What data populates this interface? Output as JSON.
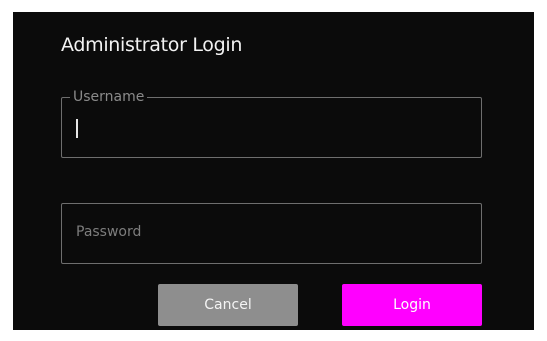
{
  "dialog": {
    "title": "Administrator Login",
    "username": {
      "label": "Username",
      "value": ""
    },
    "password": {
      "placeholder": "Password",
      "value": ""
    },
    "buttons": {
      "cancel_label": "Cancel",
      "login_label": "Login"
    }
  },
  "colors": {
    "background": "#0b0b0b",
    "accent": "#ff00ff",
    "cancel": "#8e8e8e",
    "border": "#6e6e6e"
  }
}
